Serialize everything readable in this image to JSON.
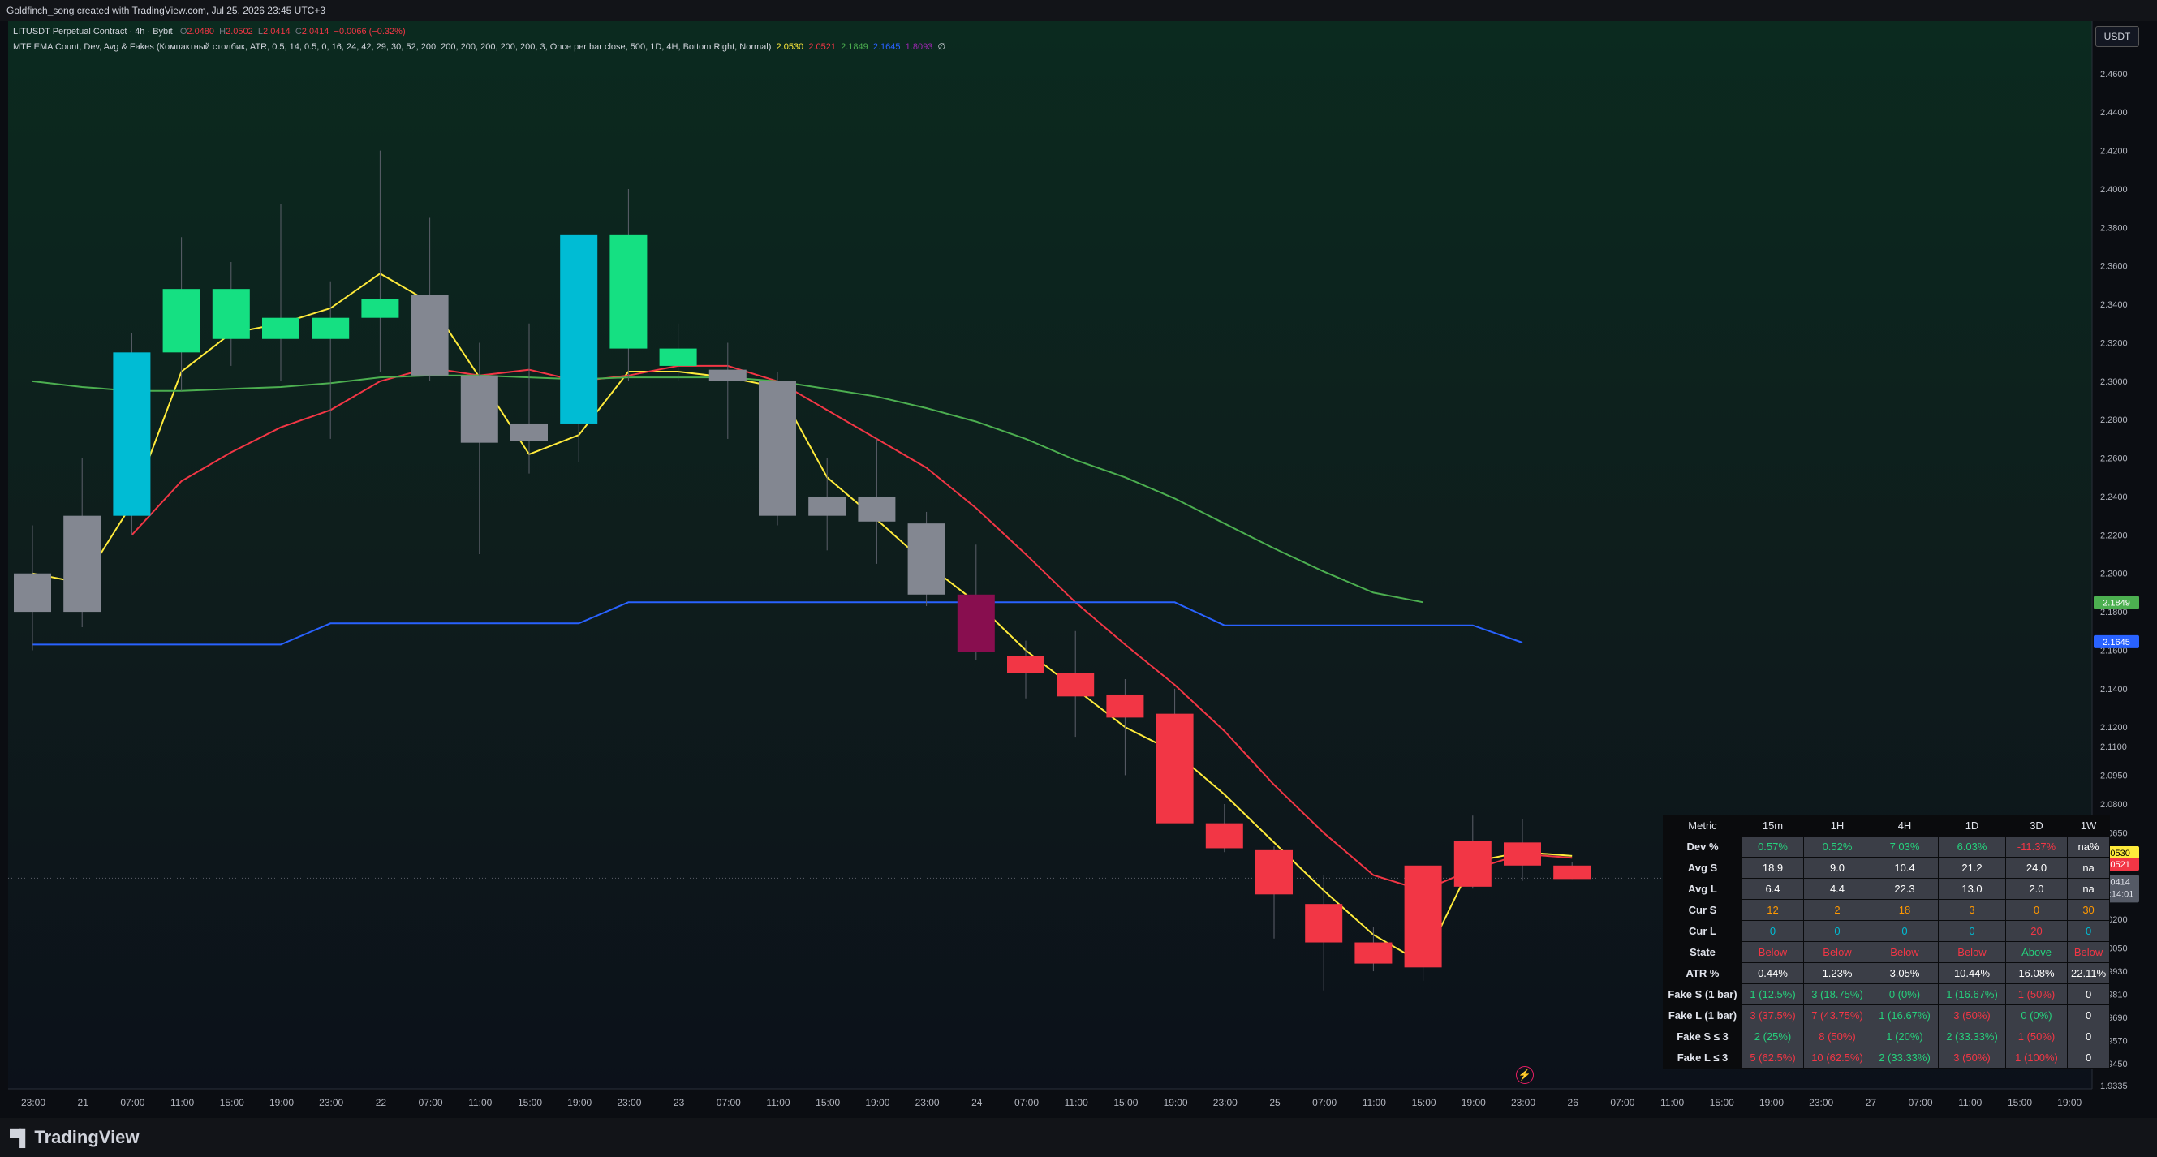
{
  "header": {
    "caption": "Goldfinch_song created with TradingView.com, Jul 25, 2026 23:45 UTC+3"
  },
  "legend": {
    "symbol": "LITUSDT Perpetual Contract · 4h · Bybit",
    "o_label": "O",
    "o_value": "2.0480",
    "h_label": "H",
    "h_value": "2.0502",
    "l_label": "L",
    "l_value": "2.0414",
    "c_label": "C",
    "c_value": "2.0414",
    "change": "−0.0066 (−0.32%)",
    "indicator": "MTF EMA Count, Dev, Avg & Fakes (Компактный столбик, ATR, 0.5, 14, 0.5, 0, 16, 24, 42, 29, 30, 52, 200, 200, 200, 200, 200, 200, 3, Once per bar close, 500, 1D, 4H, Bottom Right, Normal)",
    "ind_v1": "2.0530",
    "ind_v2": "2.0521",
    "ind_v3": "2.1849",
    "ind_v4": "2.1645",
    "ind_v5": "1.8093",
    "ind_v6": "∅"
  },
  "currency": "USDT",
  "brand": "TradingView",
  "colors": {
    "up_green": "#15e082",
    "up_cyan": "#00bcd4",
    "neutral_gray": "#838791",
    "down_red": "#f23645",
    "down_maroon": "#880e4f",
    "ema_yellow": "#ffeb3b",
    "ema_red": "#f23645",
    "ema_green": "#4caf50",
    "ema_blue": "#2962ff"
  },
  "chart_data": {
    "type": "candlestick",
    "timeframe": "4h",
    "ylim": [
      1.9335,
      2.4705
    ],
    "y_ticks": [
      "2.4600",
      "2.4400",
      "2.4200",
      "2.4000",
      "2.3800",
      "2.3600",
      "2.3400",
      "2.3200",
      "2.3000",
      "2.2800",
      "2.2600",
      "2.2400",
      "2.2200",
      "2.2000",
      "2.1800",
      "2.1600",
      "2.1400",
      "2.1200",
      "2.1100",
      "2.0950",
      "2.0800",
      "2.0650",
      "2.0500",
      "2.0350",
      "2.0200",
      "2.0050",
      "1.9930",
      "1.9810",
      "1.9690",
      "1.9570",
      "1.9450",
      "1.9335"
    ],
    "x_ticks": [
      "23:00",
      "21",
      "07:00",
      "11:00",
      "15:00",
      "19:00",
      "23:00",
      "22",
      "07:00",
      "11:00",
      "15:00",
      "19:00",
      "23:00",
      "23",
      "07:00",
      "11:00",
      "15:00",
      "19:00",
      "23:00",
      "24",
      "07:00",
      "11:00",
      "15:00",
      "19:00",
      "23:00",
      "25",
      "07:00",
      "11:00",
      "15:00",
      "19:00",
      "23:00",
      "26",
      "07:00",
      "11:00",
      "15:00",
      "19:00",
      "23:00",
      "27",
      "07:00",
      "11:00",
      "15:00",
      "19:00"
    ],
    "candles": [
      {
        "o": 2.18,
        "h": 2.225,
        "l": 2.16,
        "c": 2.2,
        "color": "gray"
      },
      {
        "o": 2.18,
        "h": 2.26,
        "l": 2.172,
        "c": 2.23,
        "color": "gray"
      },
      {
        "o": 2.23,
        "h": 2.325,
        "l": 2.22,
        "c": 2.315,
        "color": "cyan"
      },
      {
        "o": 2.315,
        "h": 2.375,
        "l": 2.295,
        "c": 2.348,
        "color": "green"
      },
      {
        "o": 2.322,
        "h": 2.362,
        "l": 2.308,
        "c": 2.348,
        "color": "green"
      },
      {
        "o": 2.322,
        "h": 2.392,
        "l": 2.3,
        "c": 2.333,
        "color": "green"
      },
      {
        "o": 2.322,
        "h": 2.352,
        "l": 2.27,
        "c": 2.333,
        "color": "green"
      },
      {
        "o": 2.333,
        "h": 2.42,
        "l": 2.305,
        "c": 2.343,
        "color": "green"
      },
      {
        "o": 2.345,
        "h": 2.385,
        "l": 2.3,
        "c": 2.303,
        "color": "gray"
      },
      {
        "o": 2.303,
        "h": 2.32,
        "l": 2.21,
        "c": 2.268,
        "color": "gray"
      },
      {
        "o": 2.278,
        "h": 2.33,
        "l": 2.252,
        "c": 2.269,
        "color": "gray"
      },
      {
        "o": 2.278,
        "h": 2.376,
        "l": 2.258,
        "c": 2.376,
        "color": "cyan"
      },
      {
        "o": 2.317,
        "h": 2.4,
        "l": 2.3,
        "c": 2.376,
        "color": "green"
      },
      {
        "o": 2.317,
        "h": 2.33,
        "l": 2.3,
        "c": 2.308,
        "color": "green"
      },
      {
        "o": 2.306,
        "h": 2.32,
        "l": 2.27,
        "c": 2.3,
        "color": "gray"
      },
      {
        "o": 2.3,
        "h": 2.305,
        "l": 2.225,
        "c": 2.23,
        "color": "gray"
      },
      {
        "o": 2.24,
        "h": 2.26,
        "l": 2.212,
        "c": 2.23,
        "color": "gray"
      },
      {
        "o": 2.24,
        "h": 2.27,
        "l": 2.205,
        "c": 2.227,
        "color": "gray"
      },
      {
        "o": 2.226,
        "h": 2.232,
        "l": 2.183,
        "c": 2.189,
        "color": "gray"
      },
      {
        "o": 2.189,
        "h": 2.215,
        "l": 2.155,
        "c": 2.159,
        "color": "maroon"
      },
      {
        "o": 2.157,
        "h": 2.165,
        "l": 2.135,
        "c": 2.148,
        "color": "red"
      },
      {
        "o": 2.148,
        "h": 2.17,
        "l": 2.115,
        "c": 2.136,
        "color": "red"
      },
      {
        "o": 2.137,
        "h": 2.145,
        "l": 2.095,
        "c": 2.125,
        "color": "red"
      },
      {
        "o": 2.127,
        "h": 2.14,
        "l": 2.075,
        "c": 2.07,
        "color": "red"
      },
      {
        "o": 2.07,
        "h": 2.08,
        "l": 2.055,
        "c": 2.057,
        "color": "red"
      },
      {
        "o": 2.056,
        "h": 2.058,
        "l": 2.01,
        "c": 2.033,
        "color": "red"
      },
      {
        "o": 2.028,
        "h": 2.043,
        "l": 1.983,
        "c": 2.008,
        "color": "red"
      },
      {
        "o": 2.008,
        "h": 2.016,
        "l": 1.993,
        "c": 1.997,
        "color": "red"
      },
      {
        "o": 1.995,
        "h": 2.035,
        "l": 1.988,
        "c": 2.048,
        "color": "red"
      },
      {
        "o": 2.037,
        "h": 2.074,
        "l": 2.036,
        "c": 2.061,
        "color": "red"
      },
      {
        "o": 2.06,
        "h": 2.072,
        "l": 2.04,
        "c": 2.048,
        "color": "red"
      },
      {
        "o": 2.048,
        "h": 2.05,
        "l": 2.041,
        "c": 2.041,
        "color": "red"
      }
    ],
    "lines": [
      {
        "name": "2.0530",
        "color": "#ffeb3b",
        "values": [
          2.2,
          2.195,
          2.236,
          2.305,
          2.325,
          2.33,
          2.338,
          2.356,
          2.341,
          2.302,
          2.262,
          2.272,
          2.305,
          2.305,
          2.302,
          2.297,
          2.25,
          2.228,
          2.205,
          2.185,
          2.16,
          2.14,
          2.12,
          2.107,
          2.085,
          2.06,
          2.035,
          2.012,
          1.997,
          2.05,
          2.055,
          2.053
        ]
      },
      {
        "name": "2.0521",
        "color": "#f23645",
        "values": [
          null,
          null,
          2.22,
          2.248,
          2.263,
          2.276,
          2.285,
          2.3,
          2.307,
          2.303,
          2.306,
          2.3,
          2.303,
          2.308,
          2.308,
          2.3,
          2.285,
          2.27,
          2.255,
          2.234,
          2.21,
          2.185,
          2.163,
          2.142,
          2.118,
          2.09,
          2.065,
          2.043,
          2.035,
          2.046,
          2.054,
          2.052
        ]
      },
      {
        "name": "2.1849",
        "color": "#4caf50",
        "values": [
          2.3,
          2.297,
          2.295,
          2.295,
          2.296,
          2.297,
          2.299,
          2.302,
          2.303,
          2.303,
          2.302,
          2.301,
          2.302,
          2.302,
          2.302,
          2.3,
          2.296,
          2.292,
          2.286,
          2.279,
          2.27,
          2.259,
          2.25,
          2.239,
          2.226,
          2.213,
          2.201,
          2.19,
          2.185
        ]
      },
      {
        "name": "2.1645",
        "color": "#2962ff",
        "values": [
          2.163,
          2.163,
          2.163,
          2.163,
          2.163,
          2.163,
          2.174,
          2.174,
          2.174,
          2.174,
          2.174,
          2.174,
          2.185,
          2.185,
          2.185,
          2.185,
          2.185,
          2.185,
          2.185,
          2.185,
          2.185,
          2.185,
          2.185,
          2.185,
          2.173,
          2.173,
          2.173,
          2.173,
          2.173,
          2.173,
          2.164
        ]
      }
    ],
    "price_tags": [
      {
        "value": "2.1849",
        "y": 2.1849,
        "color": "#4caf50",
        "text_color": "#ffffff"
      },
      {
        "value": "2.1645",
        "y": 2.1645,
        "color": "#2962ff",
        "text_color": "#ffffff"
      },
      {
        "value": "2.0530",
        "y": 2.053,
        "color": "#ffeb3b",
        "text_color": "#000000"
      },
      {
        "value": "2.0521",
        "y": 2.0521,
        "color": "#f23645",
        "text_color": "#ffffff"
      },
      {
        "value": "2.0414",
        "y": 2.0414,
        "color": "#555a66",
        "text_color": "#e0e3eb"
      }
    ],
    "countdown": "03:14:01",
    "current_price": 2.0414
  },
  "table": {
    "headers": [
      "Metric",
      "15m",
      "1H",
      "4H",
      "1D",
      "3D",
      "1W"
    ],
    "rows": [
      {
        "label": "Dev %",
        "cells": [
          {
            "t": "0.57%",
            "c": "green"
          },
          {
            "t": "0.52%",
            "c": "green"
          },
          {
            "t": "7.03%",
            "c": "green"
          },
          {
            "t": "6.03%",
            "c": "green"
          },
          {
            "t": "-11.37%",
            "c": "red"
          },
          {
            "t": "na%",
            "c": "white"
          }
        ]
      },
      {
        "label": "Avg S",
        "cells": [
          {
            "t": "18.9",
            "c": "white"
          },
          {
            "t": "9.0",
            "c": "white"
          },
          {
            "t": "10.4",
            "c": "white"
          },
          {
            "t": "21.2",
            "c": "white"
          },
          {
            "t": "24.0",
            "c": "white"
          },
          {
            "t": "na",
            "c": "white"
          }
        ]
      },
      {
        "label": "Avg L",
        "cells": [
          {
            "t": "6.4",
            "c": "white"
          },
          {
            "t": "4.4",
            "c": "white"
          },
          {
            "t": "22.3",
            "c": "white"
          },
          {
            "t": "13.0",
            "c": "white"
          },
          {
            "t": "2.0",
            "c": "white"
          },
          {
            "t": "na",
            "c": "white"
          }
        ]
      },
      {
        "label": "Cur S",
        "cells": [
          {
            "t": "12",
            "c": "orange"
          },
          {
            "t": "2",
            "c": "orange"
          },
          {
            "t": "18",
            "c": "orange"
          },
          {
            "t": "3",
            "c": "orange"
          },
          {
            "t": "0",
            "c": "orange"
          },
          {
            "t": "30",
            "c": "orange"
          }
        ]
      },
      {
        "label": "Cur L",
        "cells": [
          {
            "t": "0",
            "c": "cyan"
          },
          {
            "t": "0",
            "c": "cyan"
          },
          {
            "t": "0",
            "c": "cyan"
          },
          {
            "t": "0",
            "c": "cyan"
          },
          {
            "t": "20",
            "c": "red"
          },
          {
            "t": "0",
            "c": "cyan"
          }
        ]
      },
      {
        "label": "State",
        "cells": [
          {
            "t": "Below",
            "c": "red"
          },
          {
            "t": "Below",
            "c": "red"
          },
          {
            "t": "Below",
            "c": "red"
          },
          {
            "t": "Below",
            "c": "red"
          },
          {
            "t": "Above",
            "c": "green"
          },
          {
            "t": "Below",
            "c": "red"
          }
        ]
      },
      {
        "label": "ATR %",
        "cells": [
          {
            "t": "0.44%",
            "c": "white"
          },
          {
            "t": "1.23%",
            "c": "white"
          },
          {
            "t": "3.05%",
            "c": "white"
          },
          {
            "t": "10.44%",
            "c": "white"
          },
          {
            "t": "16.08%",
            "c": "white"
          },
          {
            "t": "22.11%",
            "c": "white"
          }
        ]
      },
      {
        "label": "Fake S (1 bar)",
        "cells": [
          {
            "t": "1 (12.5%)",
            "c": "green"
          },
          {
            "t": "3 (18.75%)",
            "c": "green"
          },
          {
            "t": "0 (0%)",
            "c": "green"
          },
          {
            "t": "1 (16.67%)",
            "c": "green"
          },
          {
            "t": "1 (50%)",
            "c": "red"
          },
          {
            "t": "0",
            "c": "white"
          }
        ]
      },
      {
        "label": "Fake L (1 bar)",
        "cells": [
          {
            "t": "3 (37.5%)",
            "c": "red"
          },
          {
            "t": "7 (43.75%)",
            "c": "red"
          },
          {
            "t": "1 (16.67%)",
            "c": "green"
          },
          {
            "t": "3 (50%)",
            "c": "red"
          },
          {
            "t": "0 (0%)",
            "c": "green"
          },
          {
            "t": "0",
            "c": "white"
          }
        ]
      },
      {
        "label": "Fake S ≤ 3",
        "cells": [
          {
            "t": "2 (25%)",
            "c": "green"
          },
          {
            "t": "8 (50%)",
            "c": "red"
          },
          {
            "t": "1 (20%)",
            "c": "green"
          },
          {
            "t": "2 (33.33%)",
            "c": "green"
          },
          {
            "t": "1 (50%)",
            "c": "red"
          },
          {
            "t": "0",
            "c": "white"
          }
        ]
      },
      {
        "label": "Fake L ≤ 3",
        "cells": [
          {
            "t": "5 (62.5%)",
            "c": "red"
          },
          {
            "t": "10 (62.5%)",
            "c": "red"
          },
          {
            "t": "2 (33.33%)",
            "c": "green"
          },
          {
            "t": "3 (50%)",
            "c": "red"
          },
          {
            "t": "1 (100%)",
            "c": "red"
          },
          {
            "t": "0",
            "c": "white"
          }
        ]
      }
    ]
  }
}
